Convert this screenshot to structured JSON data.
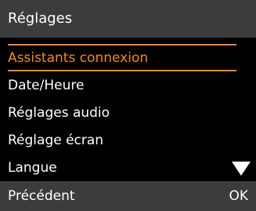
{
  "header": {
    "title": "Réglages"
  },
  "menu": {
    "items": [
      {
        "label": "Assistants connexion",
        "selected": true
      },
      {
        "label": "Date/Heure",
        "selected": false
      },
      {
        "label": "Réglages audio",
        "selected": false
      },
      {
        "label": "Réglage écran",
        "selected": false
      },
      {
        "label": "Langue",
        "selected": false
      }
    ],
    "scroll_indicator_icon": "triangle-down-icon"
  },
  "softkeys": {
    "left_label": "Précédent",
    "right_label": "OK"
  },
  "colors": {
    "background": "#000000",
    "bar_background": "#3c3c3c",
    "text": "#ffffff",
    "accent": "#f08a24"
  }
}
